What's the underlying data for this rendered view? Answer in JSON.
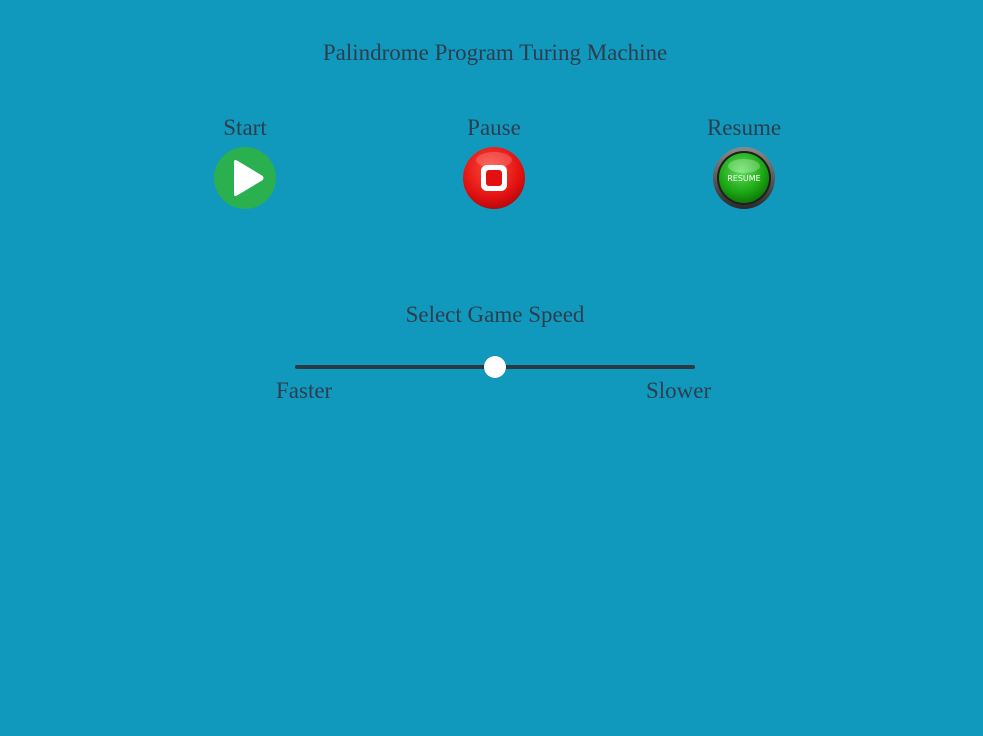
{
  "page": {
    "title": "Palindrome Program Turing Machine"
  },
  "controls": {
    "start": {
      "label": "Start",
      "icon": "play-icon",
      "color": "#2ab04f"
    },
    "pause": {
      "label": "Pause",
      "icon": "stop-icon",
      "color": "#e01010"
    },
    "resume": {
      "label": "Resume",
      "icon": "resume-icon",
      "icon_text": "RESUME",
      "color": "#1aa512"
    }
  },
  "speed": {
    "label": "Select Game Speed",
    "min_label": "Faster",
    "max_label": "Slower",
    "value_fraction": 0.5
  },
  "colors": {
    "background": "#1199bd",
    "text": "#2c3e50",
    "track": "#2b3a42",
    "thumb": "#ffffff"
  }
}
